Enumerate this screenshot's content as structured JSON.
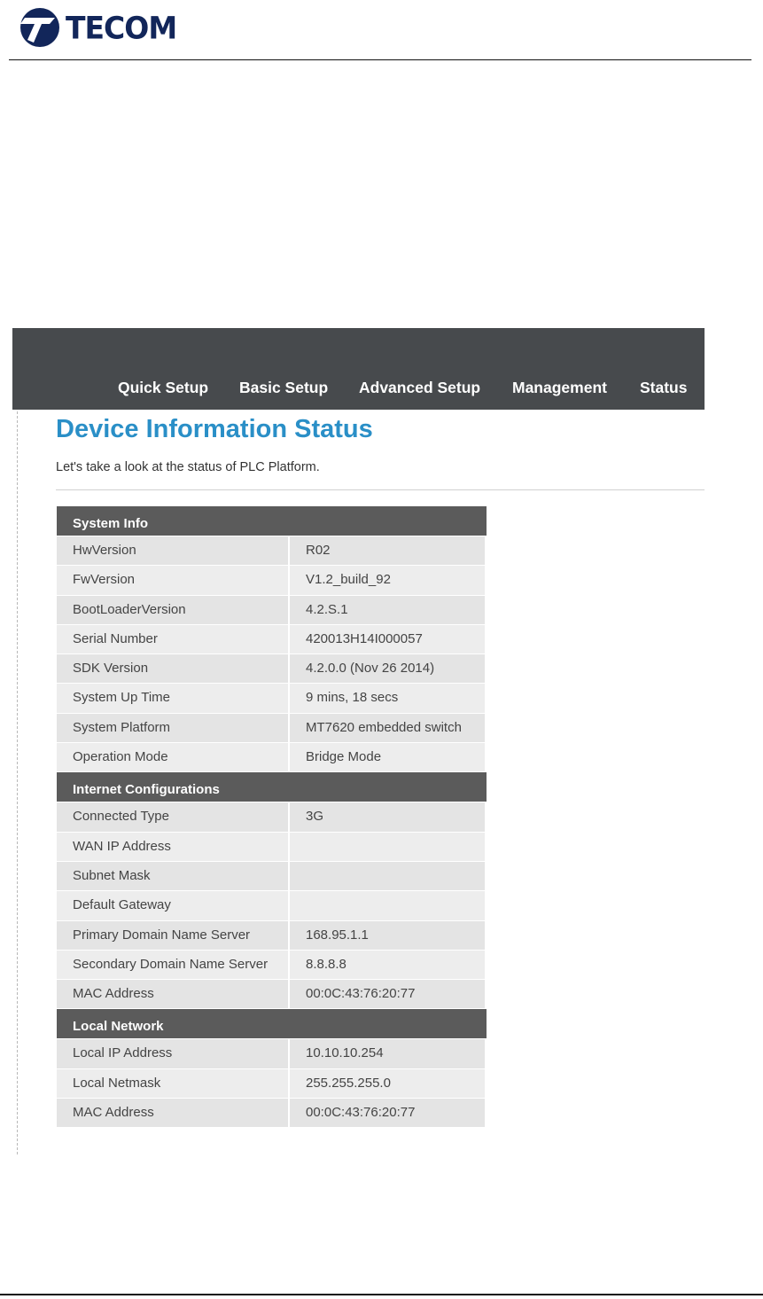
{
  "brand": {
    "name": "TECOM"
  },
  "nav": {
    "items": [
      "Quick Setup",
      "Basic Setup",
      "Advanced Setup",
      "Management",
      "Status"
    ]
  },
  "page": {
    "title": "Device Information Status",
    "subtitle": "Let's take a look at the status of PLC Platform."
  },
  "sections": [
    {
      "title": "System Info",
      "rows": [
        {
          "label": "HwVersion",
          "value": "R02"
        },
        {
          "label": "FwVersion",
          "value": "V1.2_build_92"
        },
        {
          "label": "BootLoaderVersion",
          "value": "4.2.S.1"
        },
        {
          "label": "Serial Number",
          "value": "420013H14I000057"
        },
        {
          "label": "SDK Version",
          "value": "4.2.0.0 (Nov 26 2014)"
        },
        {
          "label": "System Up Time",
          "value": "9 mins, 18 secs"
        },
        {
          "label": "System Platform",
          "value": "MT7620 embedded switch"
        },
        {
          "label": "Operation Mode",
          "value": "Bridge Mode"
        }
      ]
    },
    {
      "title": "Internet Configurations",
      "rows": [
        {
          "label": "Connected Type",
          "value": "3G"
        },
        {
          "label": "WAN IP Address",
          "value": ""
        },
        {
          "label": "Subnet Mask",
          "value": ""
        },
        {
          "label": "Default Gateway",
          "value": ""
        },
        {
          "label": "Primary Domain Name Server",
          "value": "168.95.1.1"
        },
        {
          "label": "Secondary Domain Name Server",
          "value": "8.8.8.8"
        },
        {
          "label": "MAC Address",
          "value": "00:0C:43:76:20:77"
        }
      ]
    },
    {
      "title": "Local Network",
      "rows": [
        {
          "label": "Local IP Address",
          "value": "10.10.10.254"
        },
        {
          "label": "Local Netmask",
          "value": "255.255.255.0"
        },
        {
          "label": "MAC Address",
          "value": "00:0C:43:76:20:77"
        }
      ]
    }
  ],
  "colors": {
    "nav_bg": "#474a4d",
    "title": "#2a8fc7",
    "section_header": "#5b5b5b",
    "brand": "#12265a"
  }
}
